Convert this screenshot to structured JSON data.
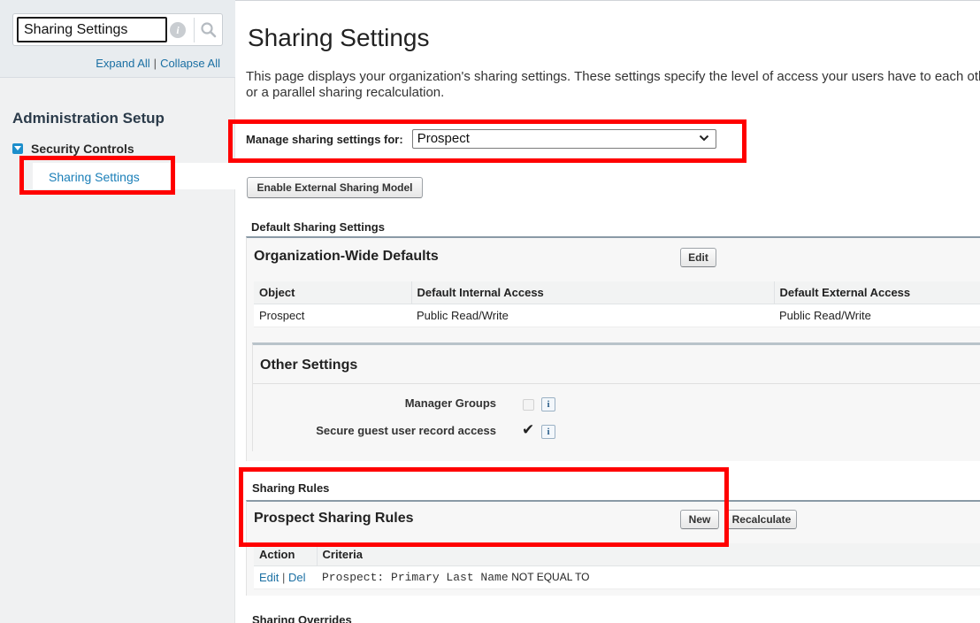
{
  "sidebar": {
    "search": {
      "value": "Sharing Settings"
    },
    "expand_all": "Expand All",
    "link_separator": "|",
    "collapse_all": "Collapse All",
    "admin_title": "Administration Setup",
    "tree": {
      "parent_label": "Security Controls",
      "child_label": "Sharing Settings"
    }
  },
  "main": {
    "title": "Sharing Settings",
    "description": "This page displays your organization's sharing settings. These settings specify the level of access your users have to each others' data or a parallel sharing recalculation.",
    "manage": {
      "label": "Manage sharing settings for:",
      "selected": "Prospect"
    },
    "enable_external_button": "Enable External Sharing Model",
    "default_sharing_heading": "Default Sharing Settings",
    "owd": {
      "title": "Organization-Wide Defaults",
      "edit_button": "Edit",
      "columns": [
        "Object",
        "Default Internal Access",
        "Default External Access"
      ],
      "rows": [
        {
          "object": "Prospect",
          "internal": "Public Read/Write",
          "external": "Public Read/Write"
        }
      ]
    },
    "other_settings": {
      "title": "Other Settings",
      "manager_groups_label": "Manager Groups",
      "secure_guest_label": "Secure guest user record access",
      "info_glyph": "i",
      "checkmark": "✔"
    },
    "sharing_rules": {
      "heading": "Sharing Rules",
      "panel_title": "Prospect Sharing Rules",
      "new_button": "New",
      "recalc_button": "Recalculate",
      "columns": [
        "Action",
        "Criteria"
      ],
      "row": {
        "edit": "Edit",
        "separator": "|",
        "del": "Del",
        "criteria_mono": "Prospect: Primary Last Name",
        "criteria_op": "NOT EQUAL TO"
      }
    },
    "sharing_overrides_heading": "Sharing Overrides"
  },
  "colors": {
    "highlight": "#ff0000",
    "link": "#1a6fa3",
    "tree_toggle": "#1d8ecb"
  },
  "icons": [
    "info-icon",
    "search-icon",
    "chevron-down-icon",
    "tree-collapse-icon",
    "checkmark-icon"
  ]
}
